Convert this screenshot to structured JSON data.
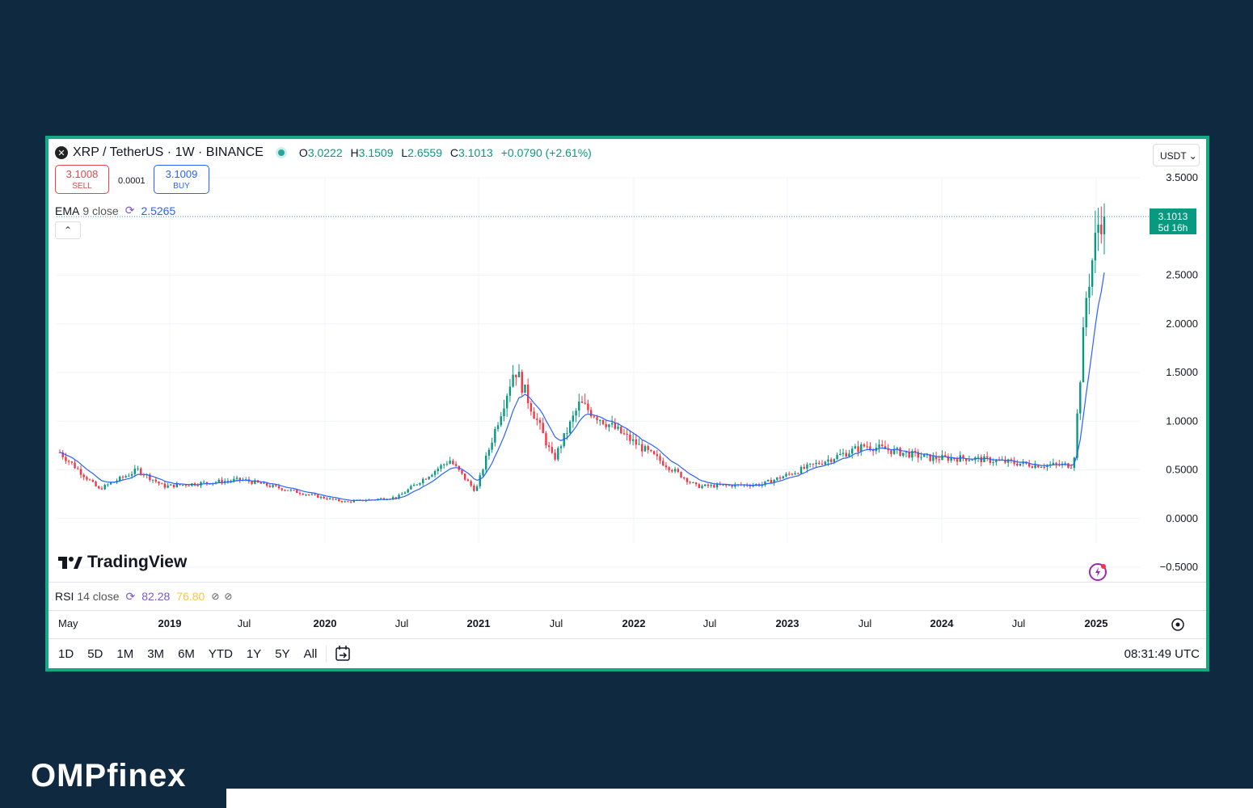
{
  "header": {
    "symbol_icon": "xrp-icon",
    "title": "XRP / TetherUS · 1W · BINANCE",
    "o_label": "O",
    "o_value": "3.0222",
    "h_label": "H",
    "h_value": "3.1509",
    "l_label": "L",
    "l_value": "2.6559",
    "c_label": "C",
    "c_value": "3.1013",
    "change": "+0.0790 (+2.61%)"
  },
  "trade": {
    "sell_price": "3.1008",
    "sell_label": "SELL",
    "spread": "0.0001",
    "buy_price": "3.1009",
    "buy_label": "BUY"
  },
  "ema": {
    "label": "EMA",
    "params": "9 close",
    "value": "2.5265"
  },
  "currency": "USDT",
  "price_tag": {
    "price": "3.1013",
    "countdown": "5d 16h"
  },
  "brand_logo": "TradingView",
  "rsi": {
    "label": "RSI",
    "params": "14 close",
    "value1": "82.28",
    "value2": "76.80",
    "icons": [
      "⊘",
      "⊘"
    ]
  },
  "time_axis": [
    "May",
    "2019",
    "Jul",
    "2020",
    "Jul",
    "2021",
    "Jul",
    "2022",
    "Jul",
    "2023",
    "Jul",
    "2024",
    "Jul",
    "2025"
  ],
  "ranges": [
    "1D",
    "5D",
    "1M",
    "3M",
    "6M",
    "YTD",
    "1Y",
    "5Y",
    "All"
  ],
  "clock": "08:31:49 UTC",
  "site_logo": "OMPfinex",
  "colors": {
    "up": "#089981",
    "down": "#f23645",
    "ema": "#2962ff",
    "accent": "#14a883",
    "bg": "#0f2a40"
  },
  "chart_data": {
    "type": "candlestick",
    "title": "XRP / TetherUS · 1W · BINANCE",
    "ylim": [
      -0.5,
      3.5
    ],
    "yticks": [
      "3.5000",
      "2.5000",
      "2.0000",
      "1.5000",
      "1.0000",
      "0.5000",
      "0.0000",
      "−0.5000"
    ],
    "approx_weekly_close": [
      [
        "2018-05",
        0.68
      ],
      [
        "2018-08",
        0.3
      ],
      [
        "2018-11",
        0.5
      ],
      [
        "2019-01",
        0.33
      ],
      [
        "2019-07",
        0.4
      ],
      [
        "2020-01",
        0.22
      ],
      [
        "2020-03",
        0.17
      ],
      [
        "2020-07",
        0.22
      ],
      [
        "2020-11",
        0.6
      ],
      [
        "2021-01",
        0.28
      ],
      [
        "2021-04",
        1.55
      ],
      [
        "2021-07",
        0.6
      ],
      [
        "2021-09",
        1.18
      ],
      [
        "2022-01",
        0.8
      ],
      [
        "2022-06",
        0.33
      ],
      [
        "2022-11",
        0.35
      ],
      [
        "2023-07",
        0.75
      ],
      [
        "2023-12",
        0.62
      ],
      [
        "2024-03",
        0.62
      ],
      [
        "2024-08",
        0.55
      ],
      [
        "2024-11",
        0.55
      ],
      [
        "2024-12",
        2.3
      ],
      [
        "2025-01",
        3.1
      ]
    ],
    "ema_last": 2.5265,
    "last_price": 3.1013
  }
}
